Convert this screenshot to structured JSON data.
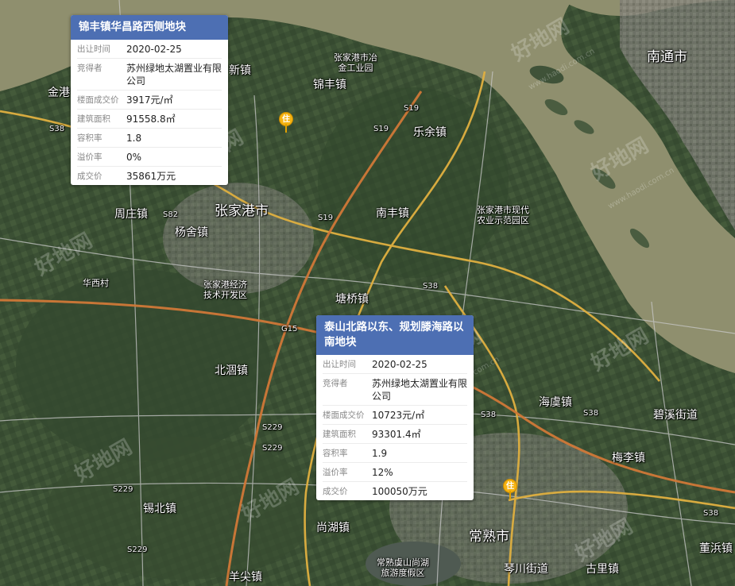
{
  "places": {
    "nantong": "南通市",
    "zhangjiagang": "张家港市",
    "changshu": "常熟市",
    "jinfeng": "锦丰镇",
    "leyu": "乐余镇",
    "nanfeng": "南丰镇",
    "zhouzhuang": "周庄镇",
    "yangshe": "杨舍镇",
    "huaxi": "华西村",
    "tangqiao": "塘桥镇",
    "beiguo": "北涸镇",
    "xibei": "锡北镇",
    "shanghu": "尚湖镇",
    "yangjian": "羊尖镇",
    "haiyu": "海虞镇",
    "meili": "梅李镇",
    "bixi": "碧溪街道",
    "dongbang": "董浜镇",
    "qinchuan": "琴川街道",
    "guli": "古里镇",
    "jingang": "金港",
    "xin": "新镇",
    "industrial_park": "张家港市冶\n金工业园",
    "agri_park": "张家港市现代\n农业示范园区",
    "econ_zone": "张家港经济\n技术开发区",
    "yushan_resort": "常熟虞山尚湖\n旅游度假区"
  },
  "roads": [
    "S38",
    "S19",
    "S19",
    "S19",
    "S38",
    "S38",
    "S38",
    "S38",
    "S82",
    "G15",
    "S229",
    "S229",
    "S229",
    "S229"
  ],
  "watermark": {
    "text": "好地网",
    "url": "www.haodi.com.cn"
  },
  "pins": {
    "label": "住"
  },
  "parcels": [
    {
      "title": "锦丰镇华昌路西侧地块",
      "fields": [
        {
          "key": "出让时间",
          "value": "2020-02-25"
        },
        {
          "key": "竞得者",
          "value": "苏州绿地太湖置业有限公司"
        },
        {
          "key": "楼面成交价",
          "value": "3917元/㎡"
        },
        {
          "key": "建筑面积",
          "value": "91558.8㎡"
        },
        {
          "key": "容积率",
          "value": "1.8"
        },
        {
          "key": "溢价率",
          "value": "0%"
        },
        {
          "key": "成交价",
          "value": "35861万元"
        }
      ]
    },
    {
      "title": "泰山北路以东、规划滕海路以南地块",
      "fields": [
        {
          "key": "出让时间",
          "value": "2020-02-25"
        },
        {
          "key": "竞得者",
          "value": "苏州绿地太湖置业有限公司"
        },
        {
          "key": "楼面成交价",
          "value": "10723元/㎡"
        },
        {
          "key": "建筑面积",
          "value": "93301.4㎡"
        },
        {
          "key": "容积率",
          "value": "1.9"
        },
        {
          "key": "溢价率",
          "value": "12%"
        },
        {
          "key": "成交价",
          "value": "100050万元"
        }
      ]
    }
  ],
  "colors": {
    "card_header": "#4d6fb3",
    "pin": "#f6b311",
    "river": "#8f8f6e",
    "land": "#3f5238",
    "road_major": "#e0b040",
    "road_orange": "#d07838"
  }
}
